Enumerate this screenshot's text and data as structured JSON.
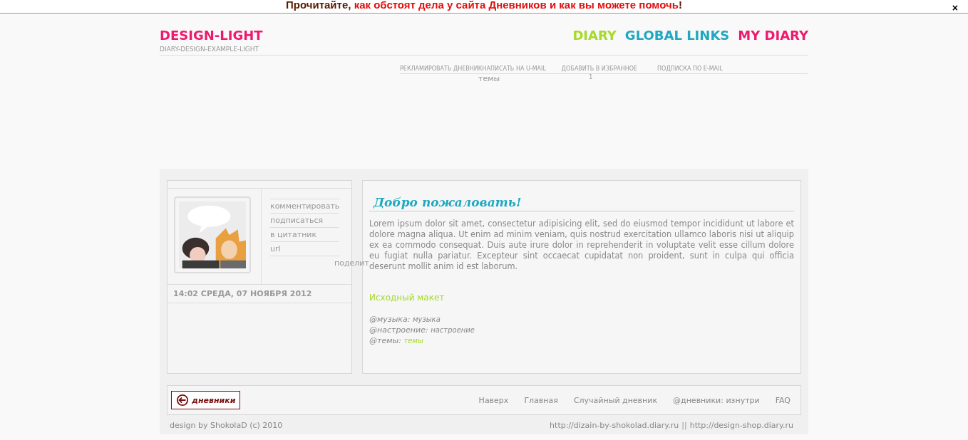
{
  "notice": {
    "lead": "Прочитайте, ",
    "link": "как обстоят дела у сайта Дневников и как вы можете помочь",
    "tail": "!",
    "close": "×"
  },
  "header": {
    "title": "DESIGN-LIGHT",
    "subtitle": "DIARY-DESIGN-EXAMPLE-LIGHT",
    "nav": [
      {
        "label": "DIARY",
        "color": "#a6d92a"
      },
      {
        "label": "GLOBAL LINKS",
        "color": "#1fa8c0"
      },
      {
        "label": "MY DIARY",
        "color": "#f0186e"
      }
    ]
  },
  "actions": [
    "РЕКЛАМИРОВАТЬ ДНЕВНИК",
    "НАПИСАТЬ НА U-MAIL",
    "ДОБАВИТЬ В ИЗБРАННОЕ",
    "ПОДПИСКА ПО E-MAIL"
  ],
  "tags": {
    "label": "темы",
    "count": "1"
  },
  "sidebar": {
    "links": [
      "комментировать",
      "подписаться",
      "в цитатник",
      "url"
    ],
    "share": "поделит",
    "date": "14:02 СРЕДА, 07 НОЯБРЯ 2012"
  },
  "post": {
    "title": "Добро пожаловать!",
    "body": "Lorem ipsum dolor sit amet, consectetur adipisicing elit, sed do eiusmod tempor incididunt ut labore et dolore magna aliqua. Ut enim ad minim veniam, quis nostrud exercitation ullamco laboris nisi ut aliquip ex ea commodo consequat. Duis aute irure dolor in reprehenderit in voluptate velit esse cillum dolore eu fugiat nulla pariatur. Excepteur sint occaecat cupidatat non proident, sunt in culpa qui officia deserunt mollit anim id est laborum.",
    "link": "Исходный макет",
    "meta": [
      {
        "label": "@музыка:",
        "value": "музыка",
        "kind": "text"
      },
      {
        "label": "@настроение:",
        "value": "настроение",
        "kind": "text"
      },
      {
        "label": "@темы:",
        "value": "темы",
        "kind": "link"
      }
    ]
  },
  "footer": {
    "logo": "дневники",
    "links": [
      "Наверх",
      "Главная",
      "Случайный дневник",
      "@дневники: изнутри",
      "FAQ"
    ],
    "credit": "design by ShokolaD (c) 2010",
    "url1": "http://dizain-by-shokolad.diary.ru",
    "sep": "||",
    "url2": "http://design-shop.diary.ru"
  }
}
